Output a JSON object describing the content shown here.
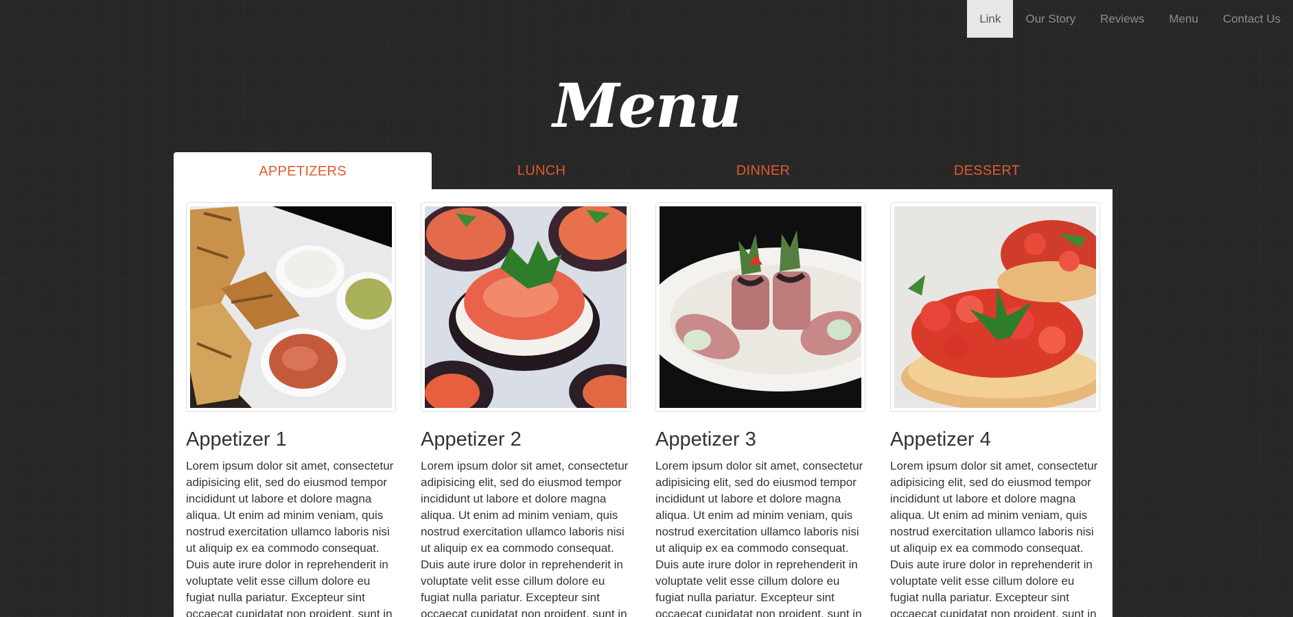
{
  "nav": {
    "items": [
      {
        "label": "Link",
        "active": true
      },
      {
        "label": "Our Story",
        "active": false
      },
      {
        "label": "Reviews",
        "active": false
      },
      {
        "label": "Menu",
        "active": false
      },
      {
        "label": "Contact Us",
        "active": false
      }
    ]
  },
  "page": {
    "title": "Menu"
  },
  "tabs": [
    {
      "label": "APPETIZERS",
      "active": true
    },
    {
      "label": "LUNCH",
      "active": false
    },
    {
      "label": "DINNER",
      "active": false
    },
    {
      "label": "DESSERT",
      "active": false
    }
  ],
  "colors": {
    "accent": "#e35a2d",
    "background": "#272727",
    "panel": "#ffffff",
    "nav_active_bg": "#e7e7e7"
  },
  "items": [
    {
      "title": "Appetizer 1",
      "photo": "bread-and-dips-photo",
      "description": "Lorem ipsum dolor sit amet, consectetur adipisicing elit, sed do eiusmod tempor incididunt ut labore et dolore magna aliqua. Ut enim ad minim veniam, quis nostrud exercitation ullamco laboris nisi ut aliquip ex ea commodo consequat. Duis aute irure dolor in reprehenderit in voluptate velit esse cillum dolore eu fugiat nulla pariatur. Excepteur sint occaecat cupidatat non proident, sunt in"
    },
    {
      "title": "Appetizer 2",
      "photo": "eggplant-tomato-bites-photo",
      "description": "Lorem ipsum dolor sit amet, consectetur adipisicing elit, sed do eiusmod tempor incididunt ut labore et dolore magna aliqua. Ut enim ad minim veniam, quis nostrud exercitation ullamco laboris nisi ut aliquip ex ea commodo consequat. Duis aute irure dolor in reprehenderit in voluptate velit esse cillum dolore eu fugiat nulla pariatur. Excepteur sint occaecat cupidatat non proident, sunt in"
    },
    {
      "title": "Appetizer 3",
      "photo": "meat-rolls-photo",
      "description": "Lorem ipsum dolor sit amet, consectetur adipisicing elit, sed do eiusmod tempor incididunt ut labore et dolore magna aliqua. Ut enim ad minim veniam, quis nostrud exercitation ullamco laboris nisi ut aliquip ex ea commodo consequat. Duis aute irure dolor in reprehenderit in voluptate velit esse cillum dolore eu fugiat nulla pariatur. Excepteur sint occaecat cupidatat non proident, sunt in"
    },
    {
      "title": "Appetizer 4",
      "photo": "bruschetta-photo",
      "description": "Lorem ipsum dolor sit amet, consectetur adipisicing elit, sed do eiusmod tempor incididunt ut labore et dolore magna aliqua. Ut enim ad minim veniam, quis nostrud exercitation ullamco laboris nisi ut aliquip ex ea commodo consequat. Duis aute irure dolor in reprehenderit in voluptate velit esse cillum dolore eu fugiat nulla pariatur. Excepteur sint occaecat cupidatat non proident, sunt in"
    }
  ]
}
